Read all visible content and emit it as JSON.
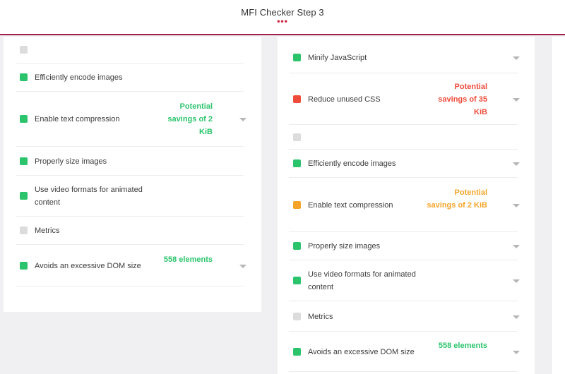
{
  "header": {
    "title": "MFI Checker Step 3",
    "dots": "•••"
  },
  "colors": {
    "pass": "#2bc46c",
    "fail": "#ef4b3a",
    "average": "#f5a428",
    "neutral": "#dcdcdc",
    "accent": "#a31d4b"
  },
  "left_panel": {
    "items": [
      {
        "label": "",
        "status": "neutral",
        "savings": ""
      },
      {
        "label": "Efficiently encode images",
        "status": "pass",
        "savings": ""
      },
      {
        "label": "Enable text compression",
        "status": "pass",
        "savings": "Potential savings of 2 KiB"
      },
      {
        "label": "Properly size images",
        "status": "pass",
        "savings": ""
      },
      {
        "label": "Use video formats for animated content",
        "status": "pass",
        "savings": ""
      },
      {
        "label": "Metrics",
        "status": "neutral",
        "savings": ""
      },
      {
        "label": "Avoids an excessive DOM size",
        "status": "pass",
        "savings": "558 elements"
      }
    ]
  },
  "right_panel": {
    "items": [
      {
        "label": "Minify JavaScript",
        "status": "pass",
        "savings": ""
      },
      {
        "label": "Reduce unused CSS",
        "status": "fail",
        "savings": "Potential savings of 35 KiB"
      },
      {
        "label": "",
        "status": "neutral",
        "savings": ""
      },
      {
        "label": "Efficiently encode images",
        "status": "pass",
        "savings": ""
      },
      {
        "label": "Enable text compression",
        "status": "average",
        "savings": "Potential savings of 2 KiB"
      },
      {
        "label": "Properly size images",
        "status": "pass",
        "savings": ""
      },
      {
        "label": "Use video formats for animated content",
        "status": "pass",
        "savings": ""
      },
      {
        "label": "Metrics",
        "status": "neutral",
        "savings": ""
      },
      {
        "label": "Avoids an excessive DOM size",
        "status": "pass",
        "savings": "558 elements"
      }
    ]
  }
}
